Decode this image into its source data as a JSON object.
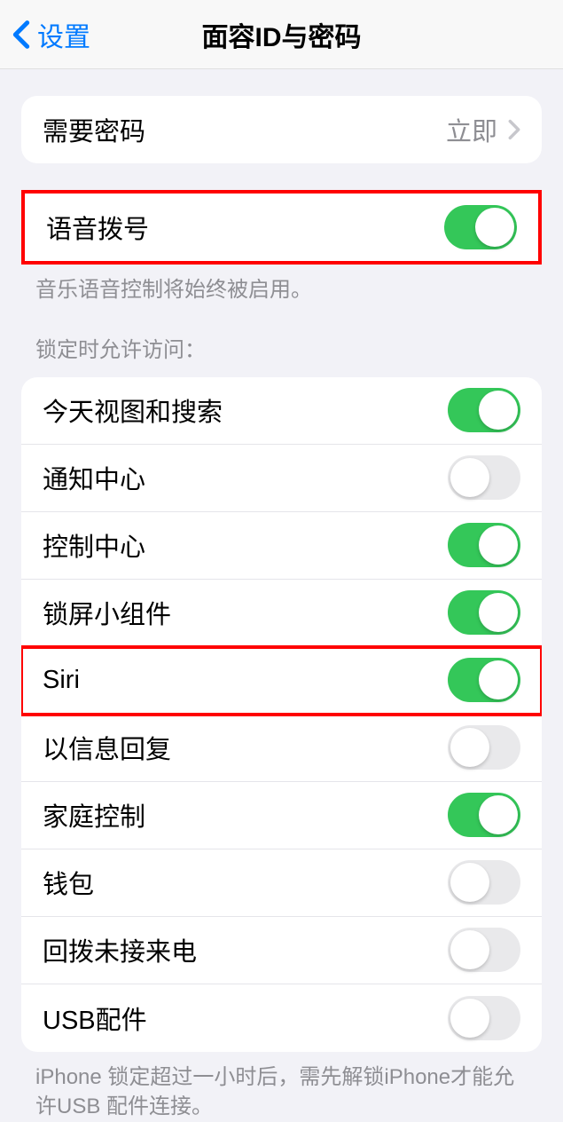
{
  "header": {
    "back_label": "设置",
    "title": "面容ID与密码"
  },
  "passcode_row": {
    "label": "需要密码",
    "value": "立即"
  },
  "voice_dial": {
    "label": "语音拨号",
    "enabled": true,
    "footer": "音乐语音控制将始终被启用。"
  },
  "lock_access": {
    "section_header": "锁定时允许访问：",
    "items": [
      {
        "label": "今天视图和搜索",
        "enabled": true
      },
      {
        "label": "通知中心",
        "enabled": false
      },
      {
        "label": "控制中心",
        "enabled": true
      },
      {
        "label": "锁屏小组件",
        "enabled": true
      },
      {
        "label": "Siri",
        "enabled": true,
        "highlighted": true
      },
      {
        "label": "以信息回复",
        "enabled": false
      },
      {
        "label": "家庭控制",
        "enabled": true
      },
      {
        "label": "钱包",
        "enabled": false
      },
      {
        "label": "回拨未接来电",
        "enabled": false
      },
      {
        "label": "USB配件",
        "enabled": false
      }
    ],
    "footer": "iPhone 锁定超过一小时后，需先解锁iPhone才能允许USB 配件连接。"
  }
}
